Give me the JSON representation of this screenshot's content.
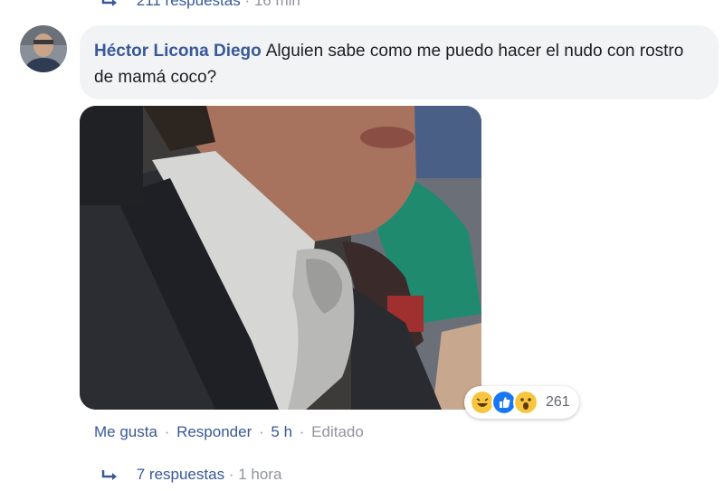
{
  "previous_thread": {
    "replies_label": "211 respuestas",
    "time": "· 16 min"
  },
  "comment": {
    "author": "Héctor Licona Diego",
    "text": "Alguien sabe como me puedo hacer el nudo con rostro de mamá coco?",
    "avatar_icon": "user-avatar",
    "photo_description_icon": "attached-photo"
  },
  "reactions": {
    "icons": [
      "haha-icon",
      "like-icon",
      "wow-icon"
    ],
    "count": "261"
  },
  "actions": {
    "like": "Me gusta",
    "reply": "Responder",
    "time": "5 h",
    "edited": "Editado",
    "separator": "·"
  },
  "replies": {
    "label": "7 respuestas",
    "time": "· 1 hora"
  },
  "colors": {
    "link": "#385898",
    "bubble": "#f2f3f5",
    "meta": "#90949c"
  }
}
